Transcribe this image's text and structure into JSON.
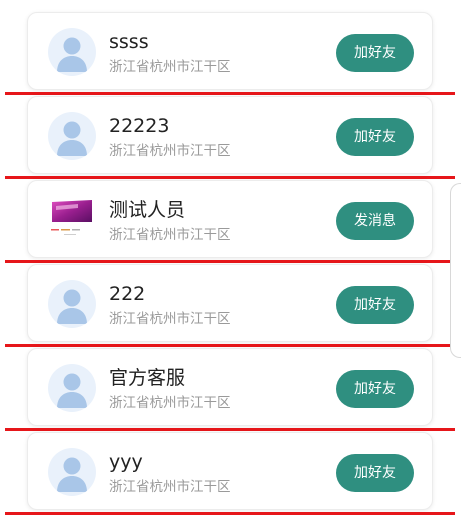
{
  "contacts": [
    {
      "name": "ssss",
      "location": "浙江省杭州市江干区",
      "action": "加好友",
      "avatar": "default-user-icon"
    },
    {
      "name": "22223",
      "location": "浙江省杭州市江干区",
      "action": "加好友",
      "avatar": "default-user-icon"
    },
    {
      "name": "测试人员",
      "location": "浙江省杭州市江干区",
      "action": "发消息",
      "avatar": "photo"
    },
    {
      "name": "222",
      "location": "浙江省杭州市江干区",
      "action": "加好友",
      "avatar": "default-user-icon"
    },
    {
      "name": "官方客服",
      "location": "浙江省杭州市江干区",
      "action": "加好友",
      "avatar": "default-user-icon"
    },
    {
      "name": "yyy",
      "location": "浙江省杭州市江干区",
      "action": "加好友",
      "avatar": "default-user-icon"
    }
  ],
  "colors": {
    "button": "#2f8f80",
    "divider": "#e6161a",
    "avatar_bg": "#e9f1fb",
    "avatar_figure": "#a9c6e8"
  }
}
